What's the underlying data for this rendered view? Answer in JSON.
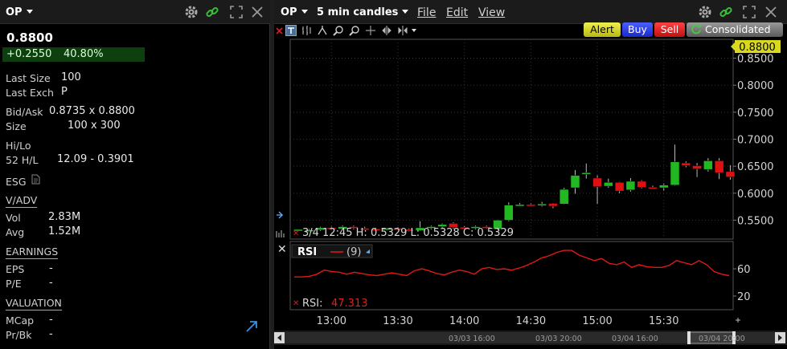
{
  "quote": {
    "symbol": "OP",
    "last": "0.8800",
    "change": "+0.2550",
    "change_pct": "40.80%",
    "last_size_label": "Last Size",
    "last_size": "100",
    "last_exch_label": "Last Exch",
    "last_exch": "P",
    "bidask_label": "Bid/Ask",
    "bidask": "0.8735 x 0.8800",
    "size_label": "Size",
    "size": "100 x 300",
    "hilo_label": "Hi/Lo",
    "h52_label": "52 H/L",
    "h52": "12.09 - 0.3901",
    "esg_label": "ESG",
    "vadv_section": "V/ADV",
    "vol_label": "Vol",
    "vol": "2.83M",
    "avg_label": "Avg",
    "avg": "1.52M",
    "earnings_section": "EARNINGS",
    "eps_label": "EPS",
    "eps": "-",
    "pe_label": "P/E",
    "pe": "-",
    "valuation_section": "VALUATION",
    "mcap_label": "MCap",
    "mcap": "-",
    "prbk_label": "Pr/Bk",
    "prbk": "-"
  },
  "chart_window": {
    "symbol": "OP",
    "candles_label": "5 min candles",
    "menu_file": "File",
    "menu_edit": "Edit",
    "menu_view": "View",
    "alert": "Alert",
    "buy": "Buy",
    "sell": "Sell",
    "consolidated": "Consolidated",
    "info_line": "3/4 12:45  H: 0.5329  L: 0.5328  C: 0.5329",
    "rsi_title": "RSI",
    "rsi_period": "(9)",
    "rsi_value_label": "RSI:",
    "rsi_value": "47.313",
    "nav_dates": [
      "03/03 16:00",
      "03/03 20:00",
      "03/04 16:00",
      "03/04 20:00"
    ],
    "colors": {
      "up": "#22b822",
      "down": "#e01010",
      "rsi_line": "#e01818",
      "last_tag": "#d8d820"
    }
  },
  "chart_data": [
    {
      "type": "candlestick",
      "title": "OP 5 min candles",
      "x_ticks": [
        "13:00",
        "13:30",
        "14:00",
        "14:30",
        "15:00",
        "15:30"
      ],
      "y_ticks": [
        0.55,
        0.6,
        0.65,
        0.7,
        0.75,
        0.8,
        0.85
      ],
      "ylim": [
        0.515,
        0.885
      ],
      "last_price": "0.8800",
      "candles": [
        {
          "t": "12:45",
          "o": 0.5329,
          "h": 0.5329,
          "l": 0.5328,
          "c": 0.5329
        },
        {
          "t": "12:50",
          "o": 0.53,
          "h": 0.534,
          "l": 0.528,
          "c": 0.532
        },
        {
          "t": "12:55",
          "o": 0.532,
          "h": 0.538,
          "l": 0.53,
          "c": 0.536
        },
        {
          "t": "13:00",
          "o": 0.536,
          "h": 0.538,
          "l": 0.532,
          "c": 0.533
        },
        {
          "t": "13:05",
          "o": 0.534,
          "h": 0.54,
          "l": 0.532,
          "c": 0.538
        },
        {
          "t": "13:10",
          "o": 0.538,
          "h": 0.54,
          "l": 0.533,
          "c": 0.535
        },
        {
          "t": "13:15",
          "o": 0.535,
          "h": 0.538,
          "l": 0.532,
          "c": 0.534
        },
        {
          "t": "13:20",
          "o": 0.534,
          "h": 0.536,
          "l": 0.531,
          "c": 0.532
        },
        {
          "t": "13:25",
          "o": 0.532,
          "h": 0.536,
          "l": 0.531,
          "c": 0.535
        },
        {
          "t": "13:30",
          "o": 0.535,
          "h": 0.537,
          "l": 0.532,
          "c": 0.533
        },
        {
          "t": "13:35",
          "o": 0.533,
          "h": 0.535,
          "l": 0.529,
          "c": 0.531
        },
        {
          "t": "13:40",
          "o": 0.531,
          "h": 0.548,
          "l": 0.53,
          "c": 0.536
        },
        {
          "t": "13:45",
          "o": 0.536,
          "h": 0.54,
          "l": 0.533,
          "c": 0.538
        },
        {
          "t": "13:50",
          "o": 0.538,
          "h": 0.544,
          "l": 0.536,
          "c": 0.542
        },
        {
          "t": "13:55",
          "o": 0.544,
          "h": 0.546,
          "l": 0.534,
          "c": 0.537
        },
        {
          "t": "14:00",
          "o": 0.537,
          "h": 0.539,
          "l": 0.533,
          "c": 0.534
        },
        {
          "t": "14:05",
          "o": 0.535,
          "h": 0.54,
          "l": 0.533,
          "c": 0.538
        },
        {
          "t": "14:10",
          "o": 0.538,
          "h": 0.54,
          "l": 0.534,
          "c": 0.535
        },
        {
          "t": "14:15",
          "o": 0.534,
          "h": 0.551,
          "l": 0.532,
          "c": 0.55
        },
        {
          "t": "14:20",
          "o": 0.55,
          "h": 0.583,
          "l": 0.548,
          "c": 0.578
        },
        {
          "t": "14:25",
          "o": 0.578,
          "h": 0.582,
          "l": 0.576,
          "c": 0.579
        },
        {
          "t": "14:30",
          "o": 0.579,
          "h": 0.581,
          "l": 0.576,
          "c": 0.578
        },
        {
          "t": "14:35",
          "o": 0.578,
          "h": 0.584,
          "l": 0.575,
          "c": 0.58
        },
        {
          "t": "14:40",
          "o": 0.581,
          "h": 0.582,
          "l": 0.572,
          "c": 0.576
        },
        {
          "t": "14:45",
          "o": 0.58,
          "h": 0.61,
          "l": 0.579,
          "c": 0.607
        },
        {
          "t": "14:50",
          "o": 0.61,
          "h": 0.643,
          "l": 0.599,
          "c": 0.633
        },
        {
          "t": "14:55",
          "o": 0.635,
          "h": 0.655,
          "l": 0.627,
          "c": 0.638
        },
        {
          "t": "15:00",
          "o": 0.628,
          "h": 0.633,
          "l": 0.58,
          "c": 0.612
        },
        {
          "t": "15:05",
          "o": 0.613,
          "h": 0.627,
          "l": 0.61,
          "c": 0.62
        },
        {
          "t": "15:10",
          "o": 0.62,
          "h": 0.621,
          "l": 0.6,
          "c": 0.604
        },
        {
          "t": "15:15",
          "o": 0.606,
          "h": 0.628,
          "l": 0.603,
          "c": 0.622
        },
        {
          "t": "15:20",
          "o": 0.622,
          "h": 0.624,
          "l": 0.609,
          "c": 0.611
        },
        {
          "t": "15:25",
          "o": 0.611,
          "h": 0.614,
          "l": 0.608,
          "c": 0.61
        },
        {
          "t": "15:30",
          "o": 0.61,
          "h": 0.618,
          "l": 0.605,
          "c": 0.615
        },
        {
          "t": "15:35",
          "o": 0.615,
          "h": 0.69,
          "l": 0.614,
          "c": 0.658
        },
        {
          "t": "15:40",
          "o": 0.656,
          "h": 0.659,
          "l": 0.648,
          "c": 0.651
        },
        {
          "t": "15:45",
          "o": 0.651,
          "h": 0.656,
          "l": 0.63,
          "c": 0.645
        },
        {
          "t": "15:50",
          "o": 0.644,
          "h": 0.665,
          "l": 0.64,
          "c": 0.66
        },
        {
          "t": "15:55",
          "o": 0.66,
          "h": 0.665,
          "l": 0.626,
          "c": 0.638
        },
        {
          "t": "16:00",
          "o": 0.64,
          "h": 0.652,
          "l": 0.625,
          "c": 0.63
        }
      ]
    },
    {
      "type": "line",
      "title": "RSI (9)",
      "y_ticks": [
        20,
        60
      ],
      "ylim": [
        0,
        100
      ],
      "series": [
        {
          "name": "RSI",
          "values": [
            48,
            48,
            49,
            52,
            58,
            56,
            55,
            52,
            55,
            53,
            51,
            50,
            52,
            54,
            52,
            50,
            57,
            60,
            57,
            53,
            51,
            55,
            58,
            56,
            52,
            60,
            62,
            59,
            60,
            58,
            61,
            65,
            70,
            76,
            79,
            84,
            87,
            87,
            80,
            76,
            72,
            75,
            68,
            66,
            70,
            62,
            66,
            63,
            62,
            62,
            65,
            72,
            69,
            66,
            72,
            66,
            56,
            52,
            50
          ]
        }
      ]
    }
  ]
}
